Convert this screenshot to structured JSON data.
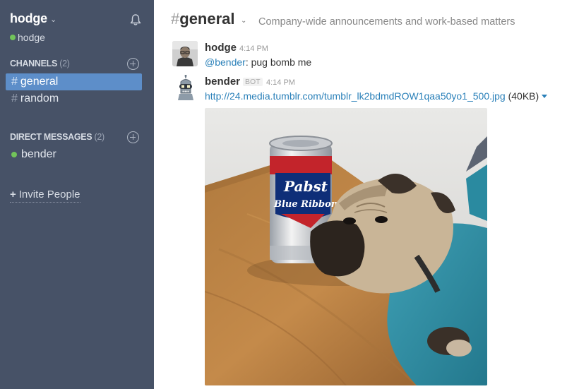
{
  "sidebar": {
    "team_name": "hodge",
    "team_caret": "⌄",
    "current_user": "hodge",
    "channels_label": "CHANNELS",
    "channels_count": "(2)",
    "channels": [
      {
        "hash": "#",
        "name": "general",
        "active": true
      },
      {
        "hash": "#",
        "name": "random",
        "active": false
      }
    ],
    "dm_label": "DIRECT MESSAGES",
    "dm_count": "(2)",
    "direct_messages": [
      {
        "name": "bender",
        "status": "online"
      }
    ],
    "invite_plus": "+",
    "invite_label": "Invite People"
  },
  "header": {
    "hash": "#",
    "channel_name": "general",
    "caret": "⌄",
    "purpose": "Company-wide announcements and work-based matters"
  },
  "messages": [
    {
      "author": "hodge",
      "time": "4:14 PM",
      "mention": "@bender",
      "text": ": pug bomb me"
    },
    {
      "author": "bender",
      "badge": "BOT",
      "time": "4:14 PM",
      "link": "http://24.media.tumblr.com/tumblr_lk2bdmdROW1qaa50yo1_500.jpg",
      "file_size": "(40KB)"
    }
  ],
  "can_label": {
    "line1": "Pabst",
    "line2": "Blue Ribbon"
  },
  "colors": {
    "sidebar_bg": "#475267",
    "active_channel": "#5d8ec9",
    "presence": "#72c45a",
    "link": "#2a80b9"
  }
}
